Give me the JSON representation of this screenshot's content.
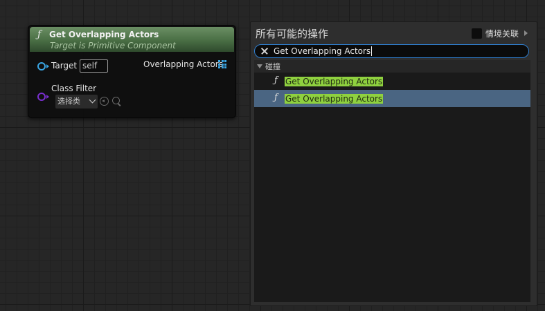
{
  "node": {
    "title": "Get Overlapping Actors",
    "subtitle": "Target is Primitive Component",
    "func_glyph": "ƒ",
    "target_label": "Target",
    "target_value": "self",
    "output_label": "Overlapping Actors",
    "class_filter_label": "Class Filter",
    "class_filter_value": "选择类",
    "icons": [
      "function-icon",
      "exec-pin-icon",
      "array-pin-icon",
      "chevron-down-icon",
      "use-selected-icon",
      "browse-icon"
    ],
    "colors": {
      "header": "#496e44",
      "pin": "#3aa7e6",
      "class_pin": "#7a2fd0"
    }
  },
  "menu": {
    "title": "所有可能的操作",
    "context_label": "情境关联",
    "search_value": "Get Overlapping Actors",
    "category": "碰撞",
    "results": [
      {
        "label": "Get Overlapping Actors",
        "selected": false
      },
      {
        "label": "Get Overlapping Actors",
        "selected": true
      }
    ],
    "colors": {
      "search_border": "#2f7fd0",
      "highlight": "#8fd13f",
      "selected_row": "#4a6582"
    }
  }
}
